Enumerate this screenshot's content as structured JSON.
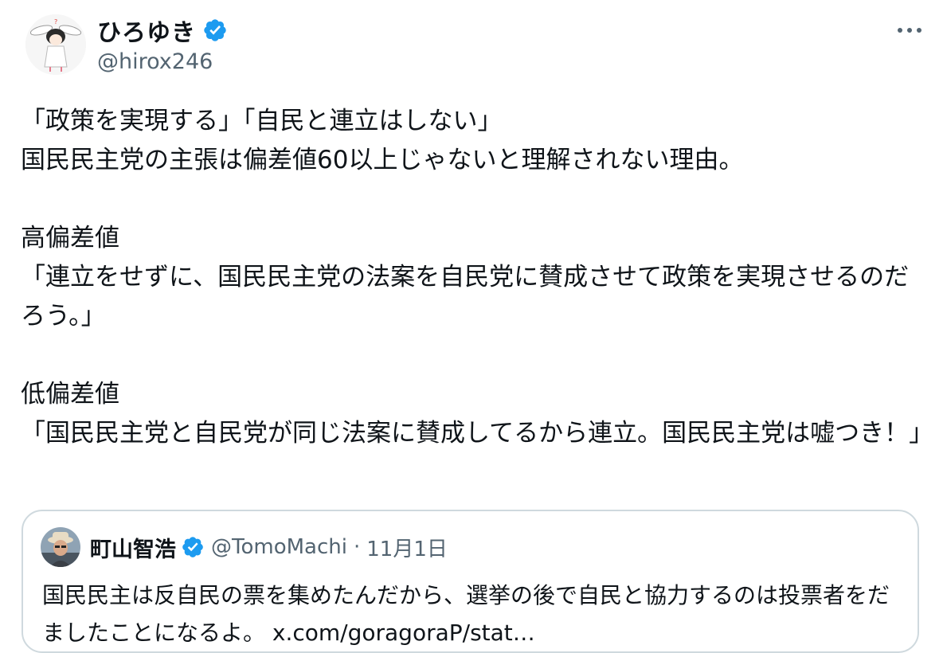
{
  "author": {
    "display_name": "ひろゆき",
    "handle": "@hirox246",
    "verified_icon": "verified-badge-icon",
    "more_icon": "more-dots-icon"
  },
  "tweet": {
    "text": "「政策を実現する」「自民と連立はしない」\n国民民主党の主張は偏差値60以上じゃないと理解されない理由。\n\n高偏差値\n「連立をせずに、国民民主党の法案を自民党に賛成させて政策を実現させるのだろう。」\n\n低偏差値\n「国民民主党と自民党が同じ法案に賛成してるから連立。国民民主党は嘘つき！」"
  },
  "quoted_tweet": {
    "display_name": "町山智浩",
    "handle": "@TomoMachi",
    "separator": "·",
    "date": "11月1日",
    "text": "国民民主は反自民の票を集めたんだから、選挙の後で自民と協力するのは投票者をだましたことになるよ。 x.com/goragoraP/stat…"
  },
  "colors": {
    "verified": "#1d9bf0",
    "text": "#0f1419",
    "secondary": "#536471",
    "border": "#cfd9de"
  }
}
